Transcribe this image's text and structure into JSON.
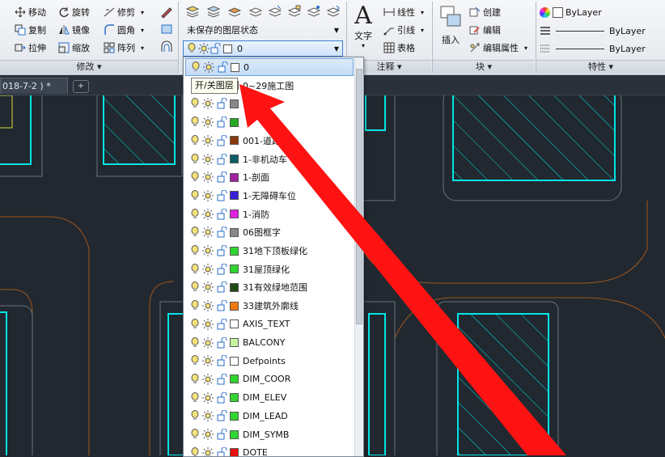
{
  "ribbon": {
    "modify": {
      "move": "移动",
      "rotate": "旋转",
      "trim": "修剪",
      "copy": "复制",
      "mirror": "镜像",
      "fillet": "圆角",
      "stretch": "拉伸",
      "scale": "缩放",
      "array": "阵列",
      "title": "修改"
    },
    "layers": {
      "state_label": "未保存的图层状态",
      "current_layer": "0"
    },
    "annotation": {
      "text_label": "文字",
      "linear": "线性",
      "leader": "引线",
      "table": "表格",
      "title": "注释"
    },
    "block": {
      "insert": "插入",
      "create": "创建",
      "edit": "编辑",
      "edit_attributes": "编辑属性",
      "title": "块"
    },
    "properties": {
      "color": "ByLayer",
      "linetype": "ByLayer",
      "lineweight": "ByLayer",
      "title": "特性"
    }
  },
  "tabs": {
    "doc_tab": "018-7-2 ) *"
  },
  "tooltip": "开/关图层",
  "layers": [
    {
      "name": "0",
      "color": "#ffffff"
    },
    {
      "name": "0~29施工图",
      "color": "#ffffff"
    },
    {
      "name": "",
      "color": "#888888"
    },
    {
      "name": "",
      "color": "#22aa22"
    },
    {
      "name": "001-道路",
      "color": "#8b3a0e"
    },
    {
      "name": "1-非机动车",
      "color": "#0c6066"
    },
    {
      "name": "1-剖面",
      "color": "#a020a0"
    },
    {
      "name": "1-无障碍车位",
      "color": "#3a1fd8"
    },
    {
      "name": "1-消防",
      "color": "#e020e0"
    },
    {
      "name": "06图框字",
      "color": "#888888"
    },
    {
      "name": "31地下顶板绿化",
      "color": "#2fd62f"
    },
    {
      "name": "31屋顶绿化",
      "color": "#2fd62f"
    },
    {
      "name": "31有效绿地范围",
      "color": "#1f4a10"
    },
    {
      "name": "33建筑外廓线",
      "color": "#f07a10"
    },
    {
      "name": "AXIS_TEXT",
      "color": "#ffffff"
    },
    {
      "name": "BALCONY",
      "color": "#c8f5a0"
    },
    {
      "name": "Defpoints",
      "color": "#ffffff"
    },
    {
      "name": "DIM_COOR",
      "color": "#2fd62f"
    },
    {
      "name": "DIM_ELEV",
      "color": "#2fd62f"
    },
    {
      "name": "DIM_LEAD",
      "color": "#2fd62f"
    },
    {
      "name": "DIM_SYMB",
      "color": "#2fd62f"
    },
    {
      "name": "DOTE",
      "color": "#e81010"
    }
  ],
  "colors": {
    "canvas": "#212830",
    "cyan": "#00e5e5",
    "gray_line": "#6b727c",
    "orange_line": "#a0561a",
    "arrow": "#ff1212"
  }
}
